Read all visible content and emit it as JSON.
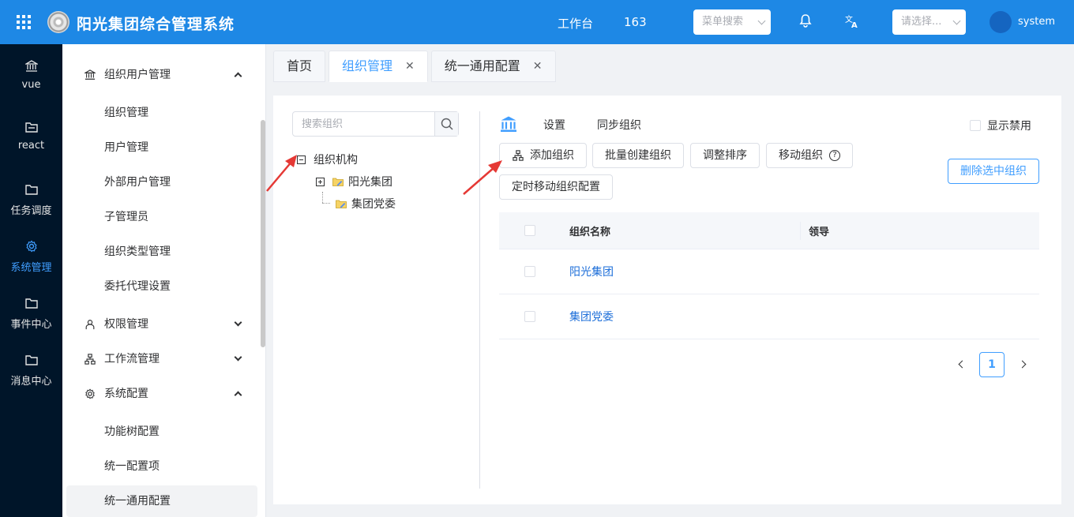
{
  "app": {
    "title": "阳光集团综合管理系统",
    "workbench": "工作台",
    "count": "163",
    "menu_search_placeholder": "菜单搜索",
    "select_placeholder": "请选择...",
    "username": "system"
  },
  "rail": [
    {
      "label": "vue",
      "icon": "bank-icon"
    },
    {
      "label": "react",
      "icon": "folder-open-icon"
    },
    {
      "label": "任务调度",
      "icon": "folder-icon"
    },
    {
      "label": "系统管理",
      "icon": "gear-icon",
      "active": true
    },
    {
      "label": "事件中心",
      "icon": "folder-icon"
    },
    {
      "label": "消息中心",
      "icon": "folder-icon"
    }
  ],
  "sidebar": {
    "group_org": "组织用户管理",
    "items_org": [
      "组织管理",
      "用户管理",
      "外部用户管理",
      "子管理员",
      "组织类型管理",
      "委托代理设置"
    ],
    "group_perm": "权限管理",
    "group_flow": "工作流管理",
    "group_sys": "系统配置",
    "items_sys": [
      "功能树配置",
      "统一配置项",
      "统一通用配置"
    ]
  },
  "tabs": [
    {
      "label": "首页",
      "closable": false
    },
    {
      "label": "组织管理",
      "closable": true,
      "active": true
    },
    {
      "label": "统一通用配置",
      "closable": true
    }
  ],
  "tree": {
    "search_placeholder": "搜索组织",
    "root": "组织机构",
    "children": [
      "阳光集团",
      "集团党委"
    ]
  },
  "toolbar": {
    "settings": "设置",
    "sync": "同步组织",
    "show_disabled": "显示禁用",
    "add_org": "添加组织",
    "batch_create": "批量创建组织",
    "adjust_order": "调整排序",
    "move_org": "移动组织",
    "scheduled_move": "定时移动组织配置",
    "delete_selected": "删除选中组织"
  },
  "table": {
    "headers": [
      "组织名称",
      "领导"
    ],
    "rows": [
      {
        "name": "阳光集团",
        "leader": ""
      },
      {
        "name": "集团党委",
        "leader": ""
      }
    ]
  },
  "pagination": {
    "current": "1"
  },
  "colors": {
    "brand": "#1e88e5",
    "rail_bg": "#001529",
    "accent": "#409eff",
    "arrow": "#e53935"
  }
}
